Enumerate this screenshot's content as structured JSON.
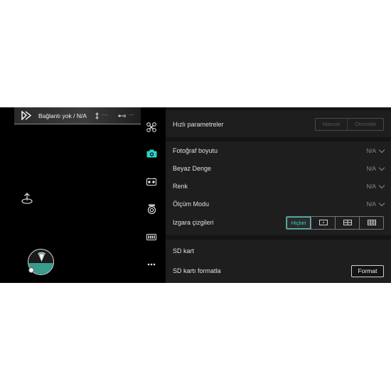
{
  "status_bar": {
    "connection": "Bağlantı yok / N/A",
    "altitude": "----",
    "distance": "---"
  },
  "tools": [
    {
      "icon": "drone-icon"
    },
    {
      "icon": "camera-icon",
      "active": true
    },
    {
      "icon": "remote-controller-icon"
    },
    {
      "icon": "gimbal-icon"
    },
    {
      "icon": "battery-icon"
    },
    {
      "icon": "more-icon"
    }
  ],
  "quick_params": {
    "label": "Hızlı parametreler",
    "manual": "Manuel",
    "auto": "Otomatik"
  },
  "photo_settings": [
    {
      "label": "Fotoğraf boyutu",
      "value": "N/A"
    },
    {
      "label": "Beyaz Denge",
      "value": "N/A"
    },
    {
      "label": "Renk",
      "value": "N/A"
    },
    {
      "label": "Ölçüm Modu",
      "value": "N/A"
    }
  ],
  "grid": {
    "label": "Izgara çizgileri",
    "none": "Hiçbiri",
    "selected": "Hiçbiri"
  },
  "sd": {
    "label": "SD kart",
    "format_label": "SD kartı formatla",
    "format_button": "Format"
  },
  "colors": {
    "accent": "#2ed3c5",
    "panel": "#1e1e1e",
    "background": "#000000"
  }
}
